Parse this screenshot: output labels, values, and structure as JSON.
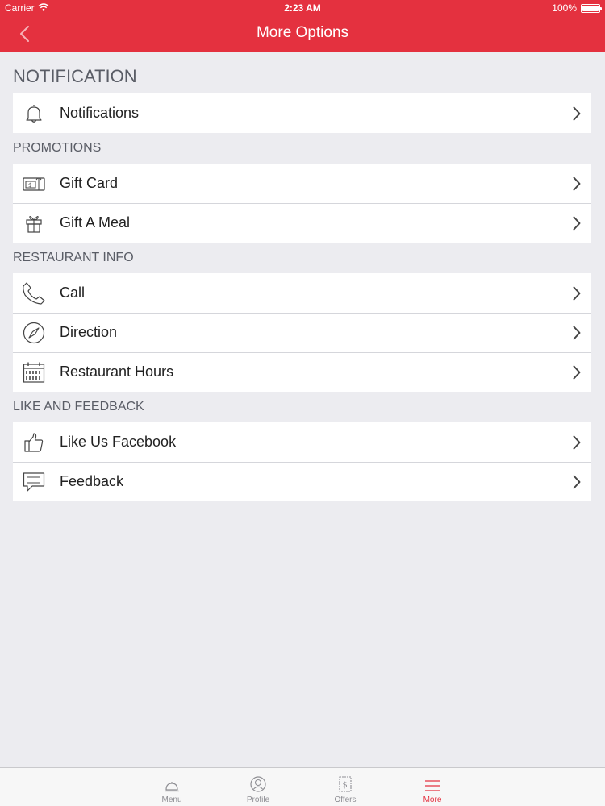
{
  "status": {
    "carrier": "Carrier",
    "time": "2:23 AM",
    "battery": "100%"
  },
  "nav": {
    "title": "More Options"
  },
  "sections": {
    "notification": {
      "header": "NOTIFICATION",
      "items": [
        {
          "label": "Notifications",
          "icon": "bell-icon"
        }
      ]
    },
    "promotions": {
      "header": "PROMOTIONS",
      "items": [
        {
          "label": "Gift Card",
          "icon": "gift-card-icon"
        },
        {
          "label": "Gift A Meal",
          "icon": "gift-box-icon"
        }
      ]
    },
    "restaurant_info": {
      "header": "RESTAURANT INFO",
      "items": [
        {
          "label": "Call",
          "icon": "phone-icon"
        },
        {
          "label": "Direction",
          "icon": "compass-icon"
        },
        {
          "label": "Restaurant Hours",
          "icon": "calendar-icon"
        }
      ]
    },
    "like_feedback": {
      "header": "LIKE AND FEEDBACK",
      "items": [
        {
          "label": "Like Us Facebook",
          "icon": "thumbs-up-icon"
        },
        {
          "label": "Feedback",
          "icon": "chat-bubble-icon"
        }
      ]
    }
  },
  "tabbar": {
    "tabs": [
      {
        "label": "Menu",
        "icon": "cloche-icon"
      },
      {
        "label": "Profile",
        "icon": "profile-icon"
      },
      {
        "label": "Offers",
        "icon": "offers-icon"
      },
      {
        "label": "More",
        "icon": "hamburger-icon",
        "active": true
      }
    ]
  },
  "colors": {
    "accent": "#e4313f",
    "background": "#ececf0",
    "section_text": "#5a5d66"
  }
}
